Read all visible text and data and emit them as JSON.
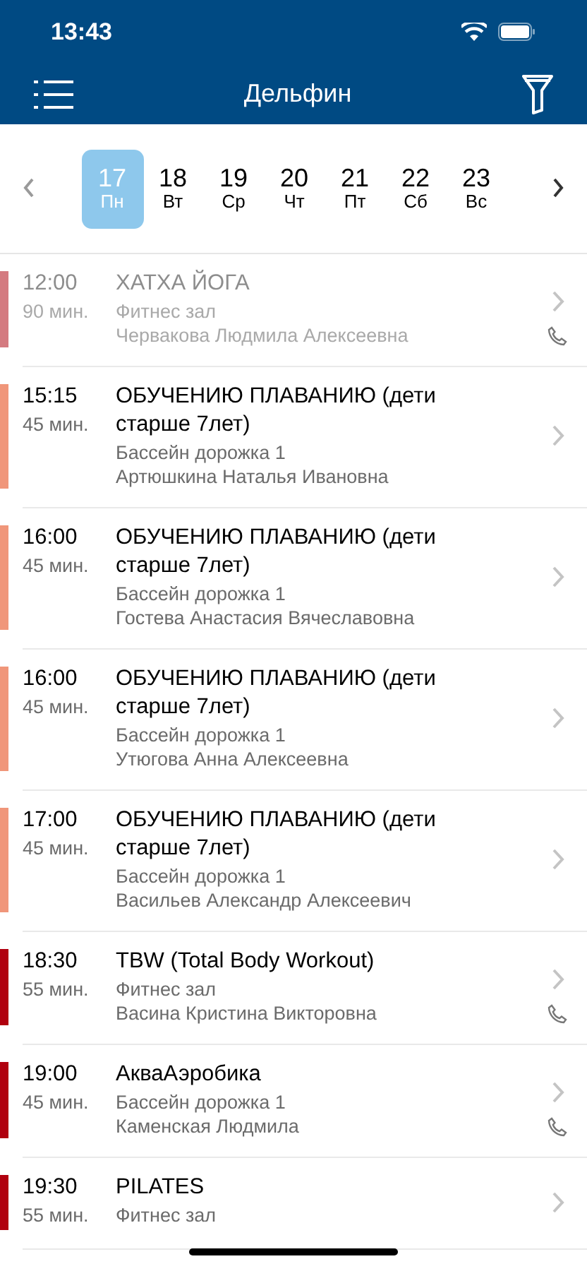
{
  "status_bar": {
    "time": "13:43"
  },
  "header": {
    "title": "Дельфин"
  },
  "days": [
    {
      "date": "17",
      "weekday": "Пн",
      "selected": true
    },
    {
      "date": "18",
      "weekday": "Вт",
      "selected": false
    },
    {
      "date": "19",
      "weekday": "Ср",
      "selected": false
    },
    {
      "date": "20",
      "weekday": "Чт",
      "selected": false
    },
    {
      "date": "21",
      "weekday": "Пт",
      "selected": false
    },
    {
      "date": "22",
      "weekday": "Сб",
      "selected": false
    },
    {
      "date": "23",
      "weekday": "Вс",
      "selected": false
    }
  ],
  "classes": [
    {
      "time": "12:00",
      "duration": "90 мин.",
      "title": "ХАТХА ЙОГА",
      "place": "Фитнес зал",
      "trainer": "Червакова Людмила Алексеевна",
      "color": "#d47a80",
      "past": true,
      "phone": true
    },
    {
      "time": "15:15",
      "duration": "45 мин.",
      "title": "ОБУЧЕНИЮ ПЛАВАНИЮ (дети старше 7лет)",
      "place": "Бассейн дорожка 1",
      "trainer": "Артюшкина Наталья Ивановна",
      "color": "#f0967a",
      "past": false,
      "phone": false
    },
    {
      "time": "16:00",
      "duration": "45 мин.",
      "title": "ОБУЧЕНИЮ ПЛАВАНИЮ (дети старше 7лет)",
      "place": "Бассейн дорожка 1",
      "trainer": "Гостева Анастасия Вячеславовна",
      "color": "#f0967a",
      "past": false,
      "phone": false
    },
    {
      "time": "16:00",
      "duration": "45 мин.",
      "title": "ОБУЧЕНИЮ ПЛАВАНИЮ (дети старше 7лет)",
      "place": "Бассейн дорожка 1",
      "trainer": "Утюгова Анна Алексеевна",
      "color": "#f0967a",
      "past": false,
      "phone": false
    },
    {
      "time": "17:00",
      "duration": "45 мин.",
      "title": "ОБУЧЕНИЮ ПЛАВАНИЮ (дети старше 7лет)",
      "place": "Бассейн дорожка 1",
      "trainer": "Васильев Александр Алексеевич",
      "color": "#f0967a",
      "past": false,
      "phone": false
    },
    {
      "time": "18:30",
      "duration": "55 мин.",
      "title": "TBW (Total Body Workout)",
      "place": "Фитнес зал",
      "trainer": "Васина Кристина Викторовна",
      "color": "#b0000f",
      "past": false,
      "phone": true
    },
    {
      "time": "19:00",
      "duration": "45 мин.",
      "title": "АкваАэробика",
      "place": "Бассейн дорожка 1",
      "trainer": "Каменская Людмила",
      "color": "#b0000f",
      "past": false,
      "phone": true
    },
    {
      "time": "19:30",
      "duration": "55 мин.",
      "title": "PILATES",
      "place": "Фитнес зал",
      "color": "#b0000f",
      "past": false,
      "phone": false
    }
  ]
}
